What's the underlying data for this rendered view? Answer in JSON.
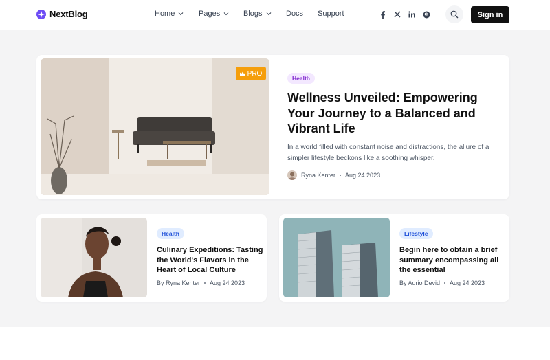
{
  "header": {
    "brand": "NextBlog",
    "nav": [
      {
        "label": "Home",
        "has_dropdown": true
      },
      {
        "label": "Pages",
        "has_dropdown": true
      },
      {
        "label": "Blogs",
        "has_dropdown": true
      },
      {
        "label": "Docs",
        "has_dropdown": false
      },
      {
        "label": "Support",
        "has_dropdown": false
      }
    ],
    "socials": [
      "facebook-icon",
      "x-icon",
      "linkedin-icon",
      "pinterest-icon"
    ],
    "search_icon": "search-icon",
    "signin_label": "Sign in"
  },
  "featured": {
    "badge": "PRO",
    "tag": "Health",
    "title": "Wellness Unveiled: Empowering Your Journey to a Balanced and Vibrant Life",
    "description": "In a world filled with constant noise and distractions, the allure of a simpler lifestyle beckons like a soothing whisper.",
    "author": "Ryna Kenter",
    "date": "Aug 24 2023"
  },
  "cards": [
    {
      "tag": "Health",
      "title": "Culinary Expeditions: Tasting the World's Flavors in the Heart of Local Culture",
      "author": "By Ryna Kenter",
      "date": "Aug 24 2023"
    },
    {
      "tag": "Lifestyle",
      "title": "Begin here to obtain a brief summary encompassing all the essential",
      "author": "By Adrio Devid",
      "date": "Aug 24 2023"
    }
  ],
  "colors": {
    "brand": "#6d4cf5",
    "pro_badge": "#f59e0b",
    "signin_bg": "#111111"
  }
}
